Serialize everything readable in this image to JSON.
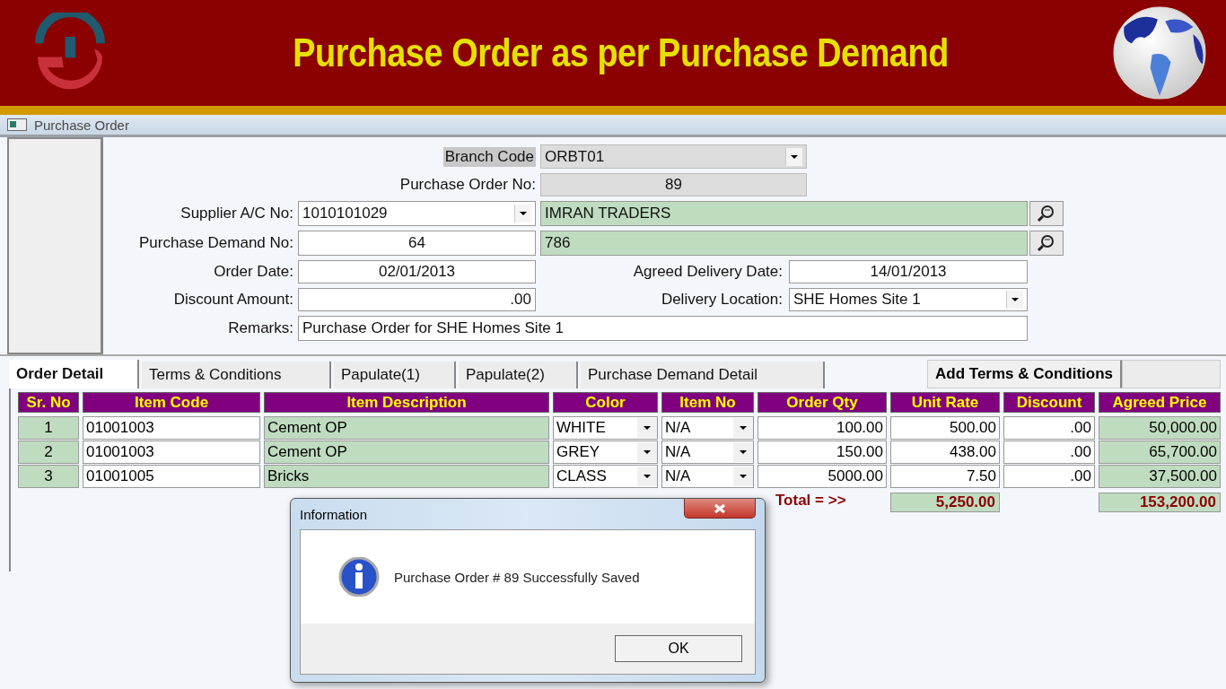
{
  "banner": {
    "title": "Purchase Order as per Purchase Demand"
  },
  "window": {
    "title": "Purchase Order"
  },
  "form": {
    "branch_code": {
      "label": "Branch Code",
      "value": "ORBT01"
    },
    "purchase_order_no": {
      "label": "Purchase Order No:",
      "value": "89"
    },
    "supplier": {
      "label": "Supplier A/C No:",
      "value": "1010101029",
      "name": "IMRAN TRADERS"
    },
    "purchase_demand": {
      "label": "Purchase Demand No:",
      "value": "64",
      "reference": "786"
    },
    "order_date": {
      "label": "Order Date:",
      "value": "02/01/2013"
    },
    "agreed_delivery_date": {
      "label": "Agreed Delivery Date:",
      "value": "14/01/2013"
    },
    "discount_amount": {
      "label": "Discount Amount:",
      "value": ".00"
    },
    "delivery_location": {
      "label": "Delivery Location:",
      "value": "SHE Homes Site 1"
    },
    "remarks": {
      "label": "Remarks:",
      "value": "Purchase Order for SHE Homes Site 1"
    }
  },
  "tabs": [
    {
      "label": "Order Detail",
      "selected": true
    },
    {
      "label": "Terms & Conditions",
      "selected": false
    },
    {
      "label": "Papulate(1)",
      "selected": false
    },
    {
      "label": "Papulate(2)",
      "selected": false
    },
    {
      "label": "Purchase Demand Detail",
      "selected": false
    }
  ],
  "add_terms_button": "Add Terms & Conditions",
  "table": {
    "columns": [
      {
        "label": "Sr. No",
        "kind": "serial"
      },
      {
        "label": "Item Code",
        "kind": "input"
      },
      {
        "label": "Item Description",
        "kind": "readonly"
      },
      {
        "label": "Color",
        "kind": "dropdown"
      },
      {
        "label": "Item No",
        "kind": "dropdown"
      },
      {
        "label": "Order Qty",
        "kind": "number"
      },
      {
        "label": "Unit Rate",
        "kind": "number"
      },
      {
        "label": "Discount",
        "kind": "number"
      },
      {
        "label": "Agreed Price",
        "kind": "amount"
      }
    ],
    "rows": [
      {
        "cells": [
          "1",
          "01001003",
          "Cement OP",
          "WHITE",
          "N/A",
          "100.00",
          "500.00",
          ".00",
          "50,000.00"
        ]
      },
      {
        "cells": [
          "2",
          "01001003",
          "Cement OP",
          "GREY",
          "N/A",
          "150.00",
          "438.00",
          ".00",
          "65,700.00"
        ]
      },
      {
        "cells": [
          "3",
          "01001005",
          "Bricks",
          "CLASS",
          "N/A",
          "5000.00",
          "7.50",
          ".00",
          "37,500.00"
        ]
      }
    ]
  },
  "totals": {
    "label": "Total = >>",
    "unit_rate": "5,250.00",
    "agreed_price": "153,200.00"
  },
  "dialog": {
    "title": "Information",
    "message": "Purchase Order # 89 Successfully Saved",
    "button": "OK"
  }
}
